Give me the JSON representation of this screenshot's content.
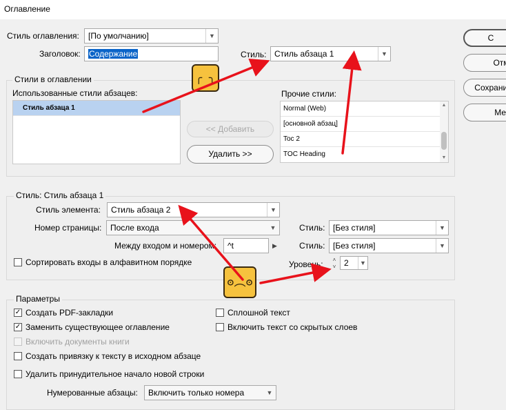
{
  "window": {
    "title": "Оглавление"
  },
  "toc_style": {
    "label": "Стиль оглавления:",
    "value": "[По умолчанию]"
  },
  "heading": {
    "label": "Заголовок:",
    "value": "Содержание"
  },
  "style": {
    "label": "Стиль:",
    "value": "Стиль абзаца 1"
  },
  "side_buttons": [
    "C",
    "Отм",
    "Сохранит",
    "Мен"
  ],
  "styles_group": {
    "title": "Стили в оглавлении",
    "used_label": "Использованные стили абзацев:",
    "used_items": [
      "Стиль абзаца 1"
    ],
    "add_button": "<< Добавить",
    "remove_button": "Удалить >>",
    "other_label": "Прочие стили:",
    "other_items": [
      "Normal (Web)",
      "[основной абзац]",
      "Toc 2",
      "TOC Heading"
    ]
  },
  "style_group": {
    "title": "Стиль: Стиль абзаца 1",
    "element_label": "Стиль элемента:",
    "element_value": "Стиль абзаца 2",
    "page_label": "Номер страницы:",
    "page_value": "После входа",
    "page_style_label": "Стиль:",
    "page_style_value": "[Без стиля]",
    "between_label": "Между входом и номером:",
    "between_value": "^t",
    "between_style_label": "Стиль:",
    "between_style_value": "[Без стиля]",
    "sort_label": "Сортировать входы в алфавитном порядке",
    "level_label": "Уровень:",
    "level_value": "2"
  },
  "params": {
    "title": "Параметры",
    "pdf_bookmarks": "Создать PDF-закладки",
    "replace_toc": "Заменить существующее оглавление",
    "include_book": "Включить документы книги",
    "anchor": "Создать привязку к тексту в исходном абзаце",
    "remove_break": "Удалить принудительное начало новой строки",
    "run_in": "Сплошной текст",
    "hidden_layers": "Включить текст со скрытых слоев",
    "numbered_label": "Нумерованные абзацы:",
    "numbered_value": "Включить только номера"
  },
  "colors": {
    "arrow": "#e8121b",
    "selection": "#0a64c8",
    "emoji": "#f6c23e"
  },
  "emoji_faces": [
    "╭ ╮",
    "ʘ︵ʘ"
  ]
}
